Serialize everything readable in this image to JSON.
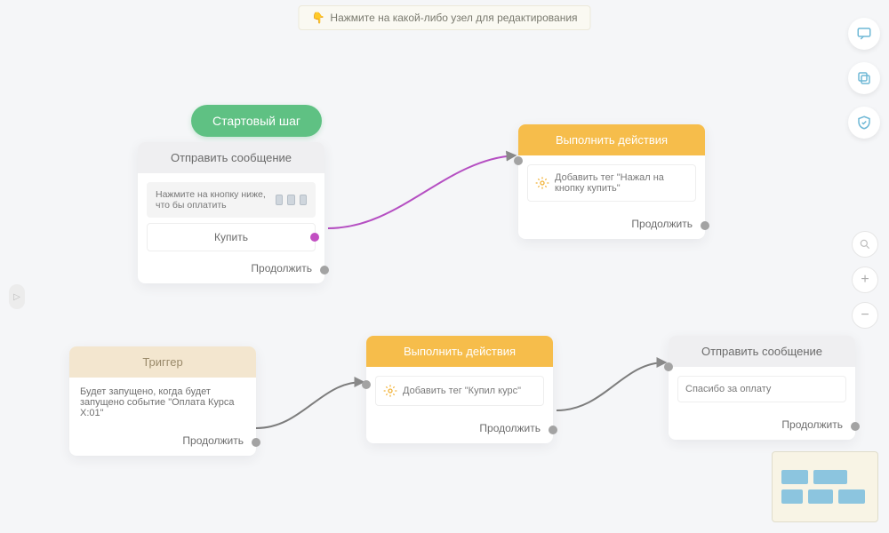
{
  "hint": {
    "emoji": "👇",
    "text": "Нажмите на какой-либо узел для редактирования"
  },
  "startPill": {
    "label": "Стартовый шаг"
  },
  "nodes": {
    "sendMsg1": {
      "title": "Отправить сообщение",
      "body": "Нажмите на кнопку ниже, что бы оплатить",
      "button": "Купить",
      "continue": "Продолжить"
    },
    "action1": {
      "title": "Выполнить действия",
      "tag": "Добавить тег \"Нажал на кнопку купить\"",
      "continue": "Продолжить"
    },
    "trigger": {
      "title": "Триггер",
      "body": "Будет запущено, когда будет запущено событие \"Оплата Курса X:01\"",
      "continue": "Продолжить"
    },
    "action2": {
      "title": "Выполнить действия",
      "tag": "Добавить тег \"Купил курс\"",
      "continue": "Продолжить"
    },
    "sendMsg2": {
      "title": "Отправить сообщение",
      "body": "Спасибо за оплату",
      "continue": "Продолжить"
    }
  },
  "toolbar": {
    "chat": "chat-icon",
    "copy": "copy-icon",
    "shield": "shield-icon",
    "search": "search-icon",
    "zoomIn": "+",
    "zoomOut": "−"
  }
}
